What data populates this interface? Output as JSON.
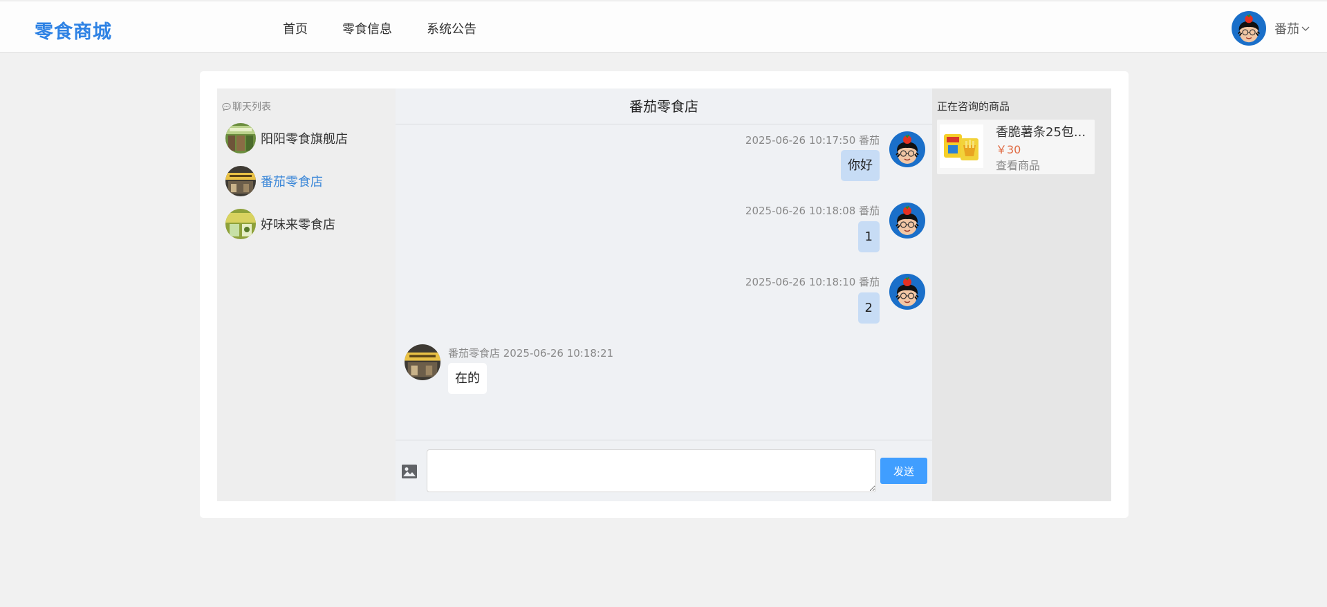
{
  "brand": "零食商城",
  "nav": {
    "items": [
      "首页",
      "零食信息",
      "系统公告"
    ]
  },
  "user": {
    "name": "番茄"
  },
  "chat_list": {
    "title": "聊天列表",
    "contacts": [
      {
        "name": "阳阳零食旗舰店",
        "active": false
      },
      {
        "name": "番茄零食店",
        "active": true
      },
      {
        "name": "好味来零食店",
        "active": false
      }
    ]
  },
  "chat": {
    "title": "番茄零食店",
    "messages": [
      {
        "side": "right",
        "meta": "2025-06-26 10:17:50 番茄",
        "text": "你好"
      },
      {
        "side": "right",
        "meta": "2025-06-26 10:18:08 番茄",
        "text": "1"
      },
      {
        "side": "right",
        "meta": "2025-06-26 10:18:10 番茄",
        "text": "2"
      },
      {
        "side": "left",
        "meta": "番茄零食店 2025-06-26 10:18:21",
        "text": "在的"
      }
    ],
    "input_value": "",
    "send_label": "发送"
  },
  "product": {
    "section_title": "正在咨询的商品",
    "name": "香脆薯条25包...",
    "price": "￥30",
    "link_label": "查看商品"
  },
  "colors": {
    "brand": "#2e82e4",
    "active_contact": "#3b87d8",
    "send_button": "#409eff",
    "my_bubble": "#c7dcf5",
    "price": "#e06b43"
  },
  "icons": [
    "chat-bubble-icon",
    "image-icon",
    "chevron-down-icon"
  ]
}
